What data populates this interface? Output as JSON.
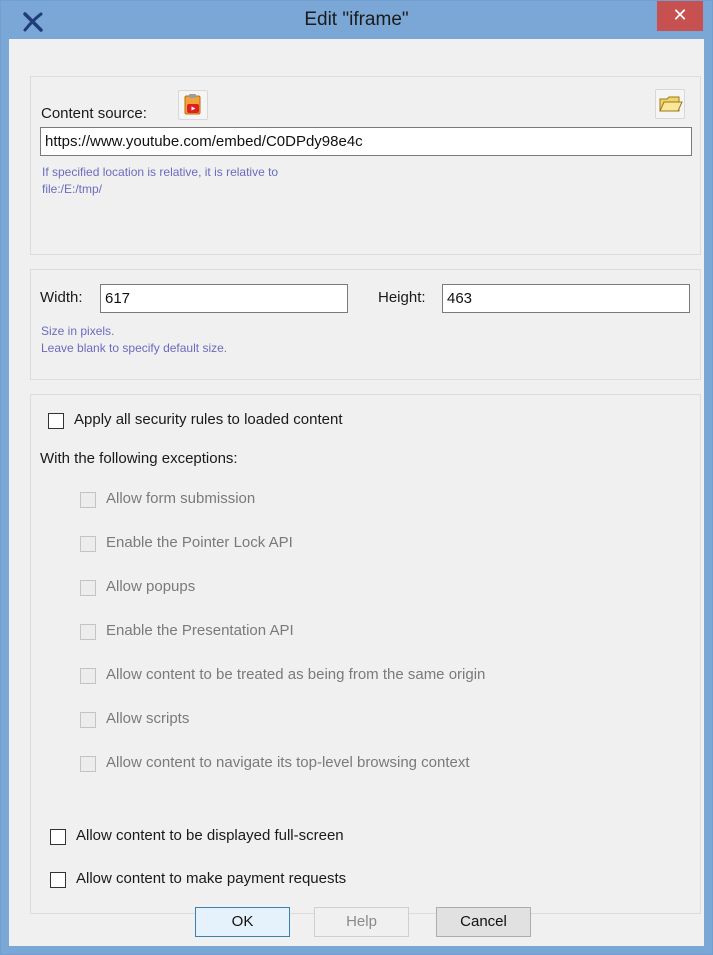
{
  "window": {
    "title": "Edit \"iframe\"",
    "close_label": "✕"
  },
  "source": {
    "label": "Content source:",
    "url": "https://www.youtube.com/embed/C0DPdy98e4c",
    "hint_line1": "If specified location is relative, it is relative to",
    "hint_line2": "file:/E:/tmp/"
  },
  "size": {
    "width_label": "Width:",
    "width_value": "617",
    "height_label": "Height:",
    "height_value": "463",
    "hint_line1": "Size in pixels.",
    "hint_line2": "Leave blank to specify default size."
  },
  "security": {
    "apply_all": {
      "label": "Apply all security rules to loaded content",
      "checked": false
    },
    "exceptions_label": "With the following exceptions:",
    "exceptions": [
      {
        "label": "Allow form submission",
        "checked": false,
        "enabled": false
      },
      {
        "label": "Enable the Pointer Lock API",
        "checked": false,
        "enabled": false
      },
      {
        "label": "Allow popups",
        "checked": false,
        "enabled": false
      },
      {
        "label": "Enable the Presentation API",
        "checked": false,
        "enabled": false
      },
      {
        "label": "Allow content to be treated as being from the same origin",
        "checked": false,
        "enabled": false
      },
      {
        "label": "Allow scripts",
        "checked": false,
        "enabled": false
      },
      {
        "label": "Allow content to navigate its top-level browsing context",
        "checked": false,
        "enabled": false
      }
    ],
    "fullscreen": {
      "label": "Allow content to be displayed full-screen",
      "checked": false
    },
    "payment": {
      "label": "Allow content to make payment requests",
      "checked": false
    }
  },
  "buttons": {
    "ok": "OK",
    "help": "Help",
    "cancel": "Cancel"
  }
}
